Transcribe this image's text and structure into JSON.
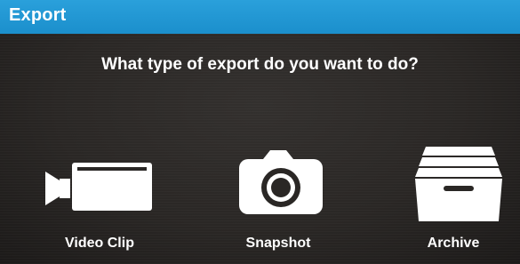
{
  "window": {
    "title": "Export"
  },
  "prompt": "What type of export do you want to do?",
  "options": [
    {
      "label": "Video Clip",
      "icon": "video-camera-icon"
    },
    {
      "label": "Snapshot",
      "icon": "camera-icon"
    },
    {
      "label": "Archive",
      "icon": "archive-box-icon"
    }
  ],
  "colors": {
    "titlebar": "#1b8fcc",
    "background": "#2a2725",
    "icon": "#ffffff",
    "text": "#ffffff"
  }
}
